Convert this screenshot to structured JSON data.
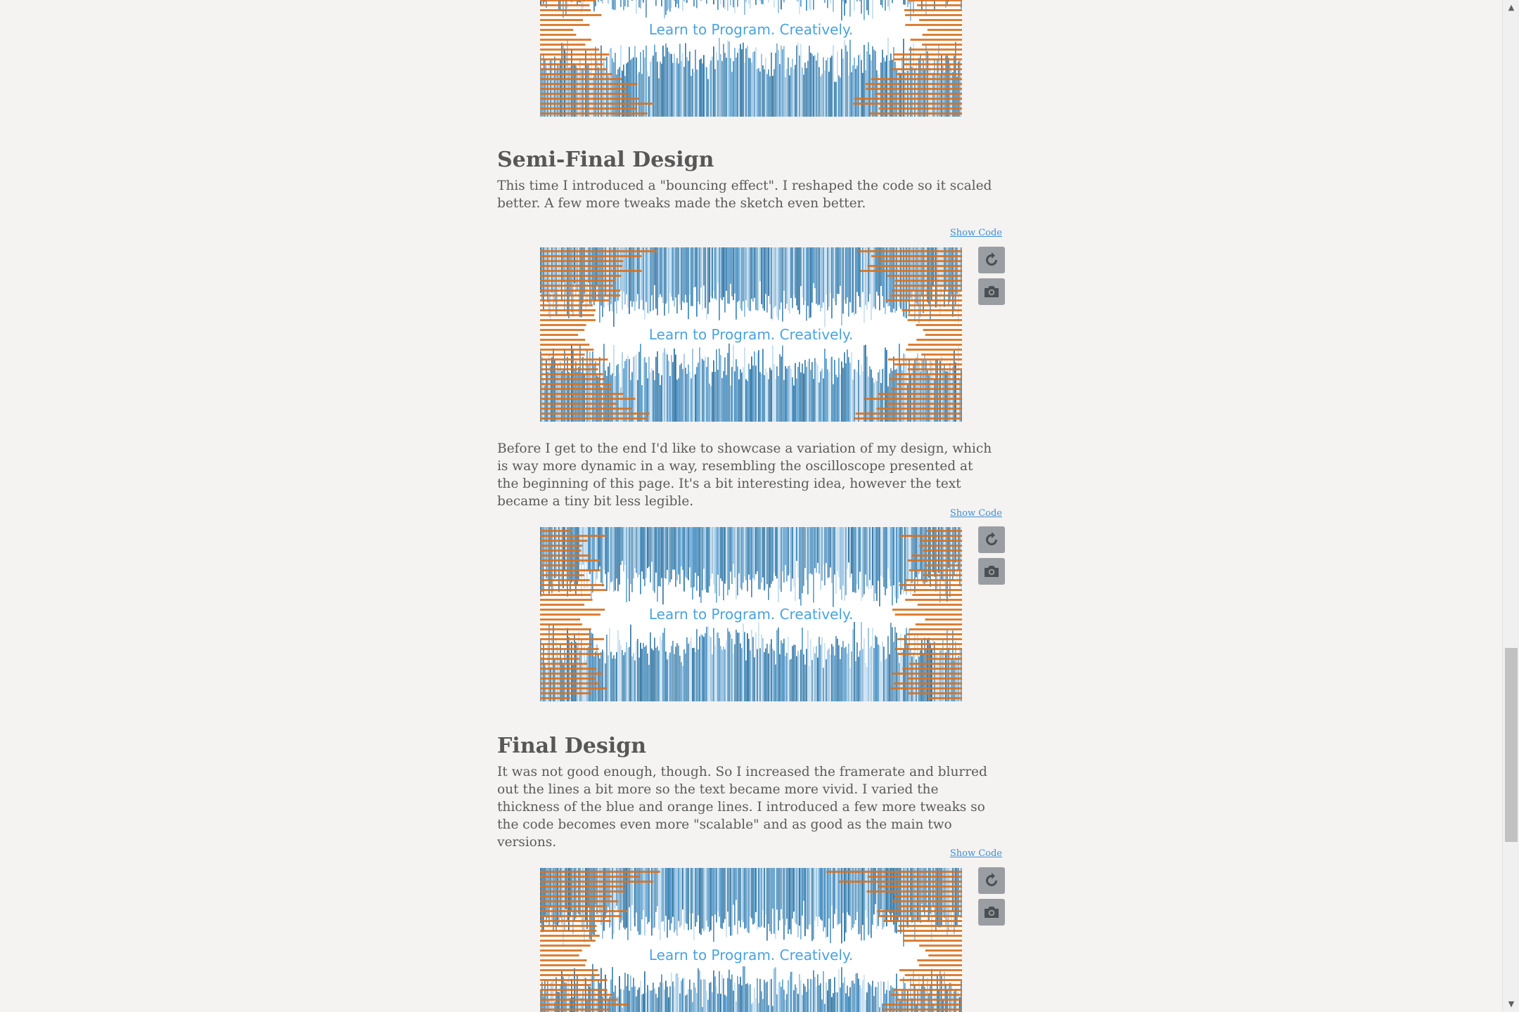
{
  "sections": {
    "semi_final": {
      "heading": "Semi-Final Design",
      "paragraph": "This time I introduced a \"bouncing effect\". I reshaped the code so it scaled better. A few more tweaks made the sketch even better."
    },
    "variation": {
      "paragraph": "Before I get to the end I'd like to showcase a variation of my design, which is way more dynamic in a way, resembling the oscilloscope presented at the beginning of this page. It's a bit interesting idea, however the text became a tiny bit less legible."
    },
    "final": {
      "heading": "Final Design",
      "paragraph": "It was not good enough, though. So I increased the framerate and blurred out the lines a bit more so the text became more vivid. I varied the thickness of the blue and orange lines. I introduced a few more tweaks so the code becomes even more \"scalable\" and as good as the main two versions."
    }
  },
  "show_code_label": "Show Code",
  "sketch_caption": "Learn to Program. Creatively.",
  "controls": {
    "restart_icon": "restart-icon",
    "snapshot_icon": "camera-icon"
  },
  "colors": {
    "blue": "#1f6fa6",
    "light_blue": "#8fc0df",
    "orange": "#d9711f",
    "caption": "#4aa3e0",
    "link": "#3f8ed6",
    "control_bg": "#9a9ea3"
  }
}
